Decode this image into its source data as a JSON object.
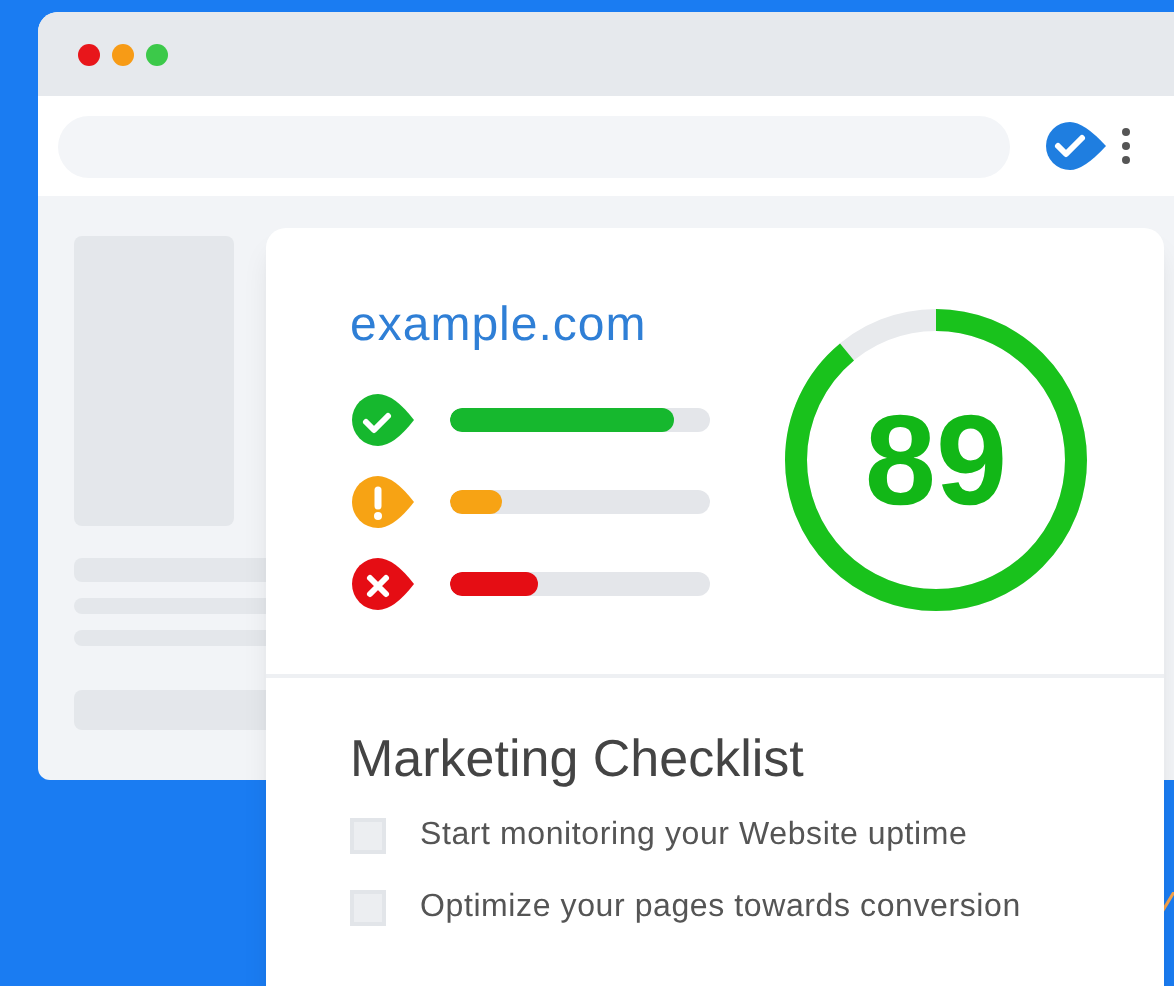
{
  "browser": {
    "window_dots": [
      {
        "color": "#e8161b"
      },
      {
        "color": "#f79b16"
      },
      {
        "color": "#3cc94a"
      }
    ]
  },
  "report": {
    "site": "example.com",
    "score": {
      "value": "89",
      "level": 0.89
    },
    "audits": [
      {
        "kind": "pass",
        "level": 0.86
      },
      {
        "kind": "warn",
        "level": 0.2
      },
      {
        "kind": "fail",
        "level": 0.34
      }
    ]
  },
  "checklist": {
    "title": "Marketing Checklist",
    "items": [
      {
        "label": "Start monitoring your Website uptime",
        "checked": false
      },
      {
        "label": "Optimize your pages towards conversion",
        "checked": false
      }
    ]
  }
}
